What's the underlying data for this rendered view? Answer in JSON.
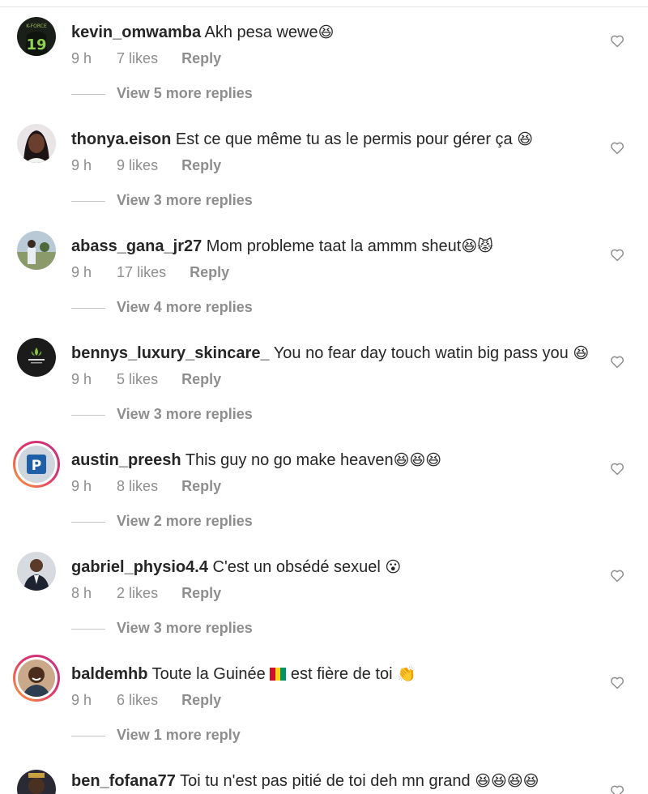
{
  "comments": [
    {
      "username": "kevin_omwamba",
      "text": "Akh pesa wewe",
      "emoji": "😆",
      "time": "9 h",
      "likes": "7 likes",
      "reply": "Reply",
      "view_replies": "View 5 more replies",
      "avatar_icon": "jersey-19-avatar"
    },
    {
      "username": "thonya.eison",
      "text": "Est ce que même tu as le permis pour gérer ça",
      "emoji": "😆",
      "time": "9 h",
      "likes": "9 likes",
      "reply": "Reply",
      "view_replies": "View 3 more replies",
      "avatar_icon": "woman-portrait-avatar"
    },
    {
      "username": "abass_gana_jr27",
      "text": "Mom probleme taat la ammm sheut",
      "emoji": "😆😾",
      "time": "9 h",
      "likes": "17 likes",
      "reply": "Reply",
      "view_replies": "View 4 more replies",
      "avatar_icon": "outdoor-person-avatar"
    },
    {
      "username": "bennys_luxury_skincare_",
      "text": "You no fear day touch watin big pass you",
      "emoji": "😆",
      "time": "9 h",
      "likes": "5 likes",
      "reply": "Reply",
      "view_replies": "View 3 more replies",
      "avatar_icon": "skincare-logo-avatar"
    },
    {
      "username": "austin_preesh",
      "text": "This guy no go make heaven",
      "emoji": "😆😆😆",
      "time": "9 h",
      "likes": "8 likes",
      "reply": "Reply",
      "view_replies": "View 2 more replies",
      "avatar_icon": "parking-p-avatar"
    },
    {
      "username": "gabriel_physio4.4",
      "text": "C'est un obsédé sexuel",
      "emoji": "😮",
      "time": "8 h",
      "likes": "2 likes",
      "reply": "Reply",
      "view_replies": "View 3 more replies",
      "avatar_icon": "man-suit-avatar"
    },
    {
      "username": "baldemhb",
      "text": "Toute la Guinée",
      "text2": "est fière de toi",
      "emoji": "👏",
      "time": "9 h",
      "likes": "6 likes",
      "reply": "Reply",
      "view_replies": "View 1 more reply",
      "avatar_icon": "smiling-man-avatar"
    },
    {
      "username": "ben_fofana77",
      "text": "Toi tu n'est pas pitié de toi deh mn grand",
      "emoji": "😆😆😆😆",
      "avatar_icon": "dark-portrait-avatar"
    }
  ],
  "colors": {
    "text": "#262626",
    "secondary": "#8e8e8e",
    "story_ring_start": "#f9a13a",
    "story_ring_end": "#c13584"
  }
}
